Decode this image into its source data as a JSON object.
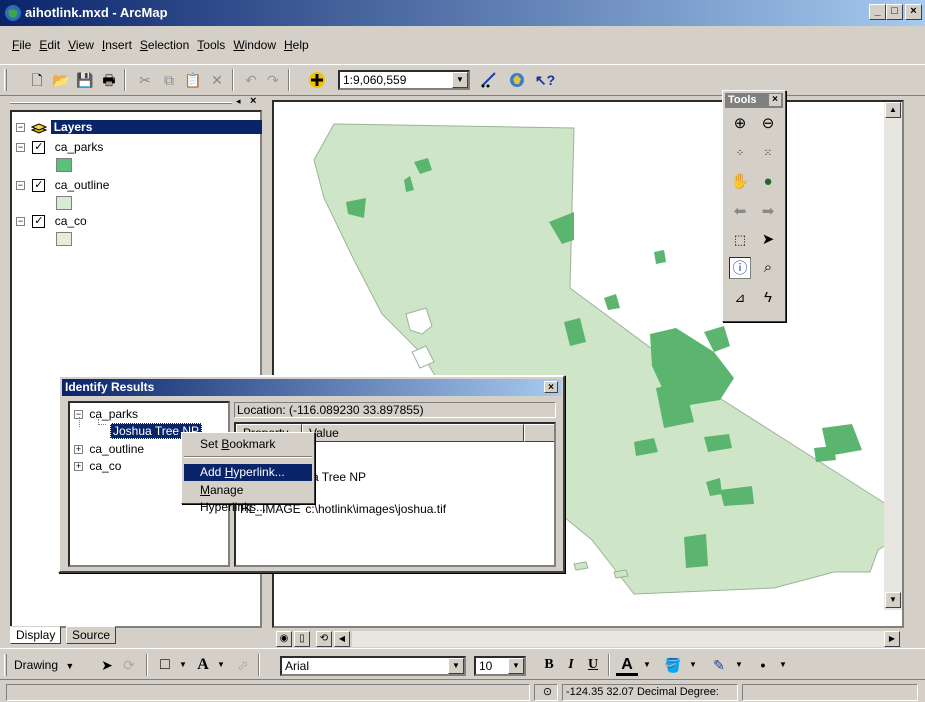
{
  "window": {
    "title": "aihotlink.mxd - ArcMap",
    "buttons": {
      "minimize": "_",
      "maximize": "□",
      "close": "×"
    }
  },
  "menu": {
    "items": [
      {
        "label": "File",
        "mnemonic": "F",
        "rest": "ile"
      },
      {
        "label": "Edit",
        "mnemonic": "E",
        "rest": "dit"
      },
      {
        "label": "View",
        "mnemonic": "V",
        "rest": "iew"
      },
      {
        "label": "Insert",
        "mnemonic": "I",
        "rest": "nsert"
      },
      {
        "label": "Selection",
        "mnemonic": "S",
        "rest": "election"
      },
      {
        "label": "Tools",
        "mnemonic": "T",
        "rest": "ools"
      },
      {
        "label": "Window",
        "mnemonic": "W",
        "rest": "indow"
      },
      {
        "label": "Help",
        "mnemonic": "H",
        "rest": "elp"
      }
    ]
  },
  "standard_toolbar": {
    "scale_value": "1:9,060,559"
  },
  "toc": {
    "root_label": "Layers",
    "layers": [
      {
        "name": "ca_parks",
        "checked": "✓",
        "color": "#5cc07a"
      },
      {
        "name": "ca_outline",
        "checked": "✓",
        "color": "#d6ecd2"
      },
      {
        "name": "ca_co",
        "checked": "✓",
        "color": "#e7ecd4"
      }
    ],
    "tabs": {
      "display": "Display",
      "source": "Source"
    }
  },
  "tools_palette": {
    "title": "Tools",
    "close": "×"
  },
  "identify": {
    "title": "Identify Results",
    "close": "×",
    "tree": [
      {
        "label": "ca_parks",
        "expander": "−"
      },
      {
        "label": "Joshua Tree NP",
        "expander": ""
      },
      {
        "label": "ca_outline",
        "expander": "+"
      },
      {
        "label": "ca_co",
        "expander": "+"
      }
    ],
    "location": "Location: (-116.089230  33.897855)",
    "columns": {
      "property": "Property",
      "value": "Value"
    },
    "rows": [
      {
        "property": "",
        "value": "ua Tree NP"
      },
      {
        "property": "HL_IMAGE",
        "value": "c:\\hotlink\\images\\joshua.tif"
      }
    ]
  },
  "context_menu": {
    "items": [
      {
        "label": "Set Bookmark",
        "pre": "Set ",
        "mn": "B",
        "post": "ookmark"
      },
      {
        "label": "Add Hyperlink...",
        "pre": "Add ",
        "mn": "H",
        "post": "yperlink..."
      },
      {
        "label": "Manage Hyperlinks...",
        "pre": "",
        "mn": "M",
        "post": "anage Hyperlinks..."
      }
    ]
  },
  "drawing_toolbar": {
    "drawing_label": "Drawing",
    "font_name": "Arial",
    "font_size": "10",
    "bold": "B",
    "italic": "I",
    "underline": "U",
    "font_color_letter": "A"
  },
  "status": {
    "coordinates": "-124.35  32.07 Decimal Degree:"
  },
  "colors": {
    "state_fill": "#cfe5c8",
    "park_fill": "#5bb56f",
    "title_start": "#0a246a",
    "title_end": "#a6caf0"
  }
}
